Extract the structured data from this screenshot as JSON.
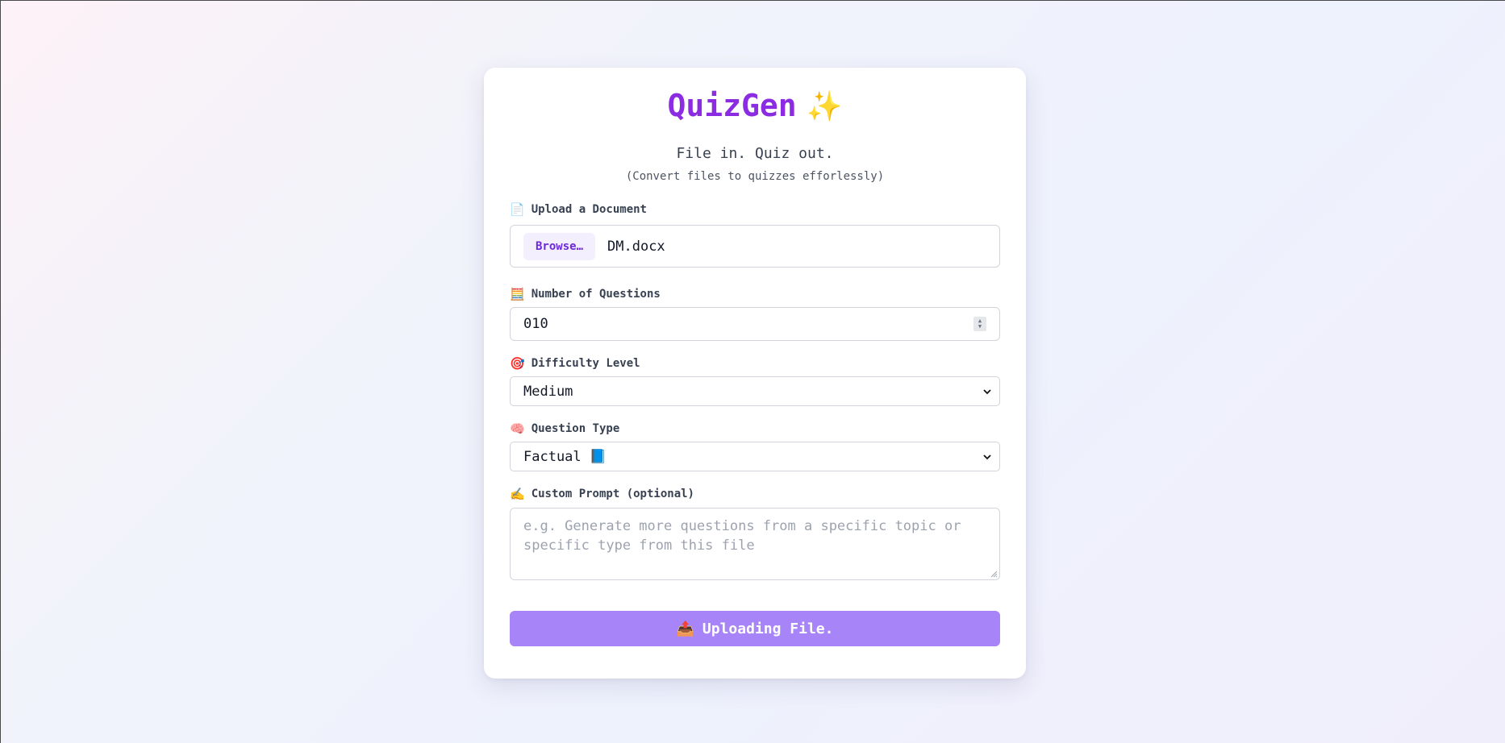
{
  "header": {
    "title": "QuizGen",
    "title_emoji": "✨",
    "subtitle": "File in. Quiz out.",
    "subnote": "(Convert files to quizzes efforlessly)"
  },
  "upload": {
    "icon": "📄",
    "label": "Upload a Document",
    "browse_label": "Browse…",
    "file_name": "DM.docx"
  },
  "questions": {
    "icon": "🧮",
    "label": "Number of Questions",
    "value": "010"
  },
  "difficulty": {
    "icon": "🎯",
    "label": "Difficulty Level",
    "selected": "Medium"
  },
  "question_type": {
    "icon": "🧠",
    "label": "Question Type",
    "selected": "Factual 📘"
  },
  "custom_prompt": {
    "icon": "✍️",
    "label": "Custom Prompt (optional)",
    "placeholder": "e.g. Generate more questions from a specific topic or specific type from this file"
  },
  "submit": {
    "icon": "📤",
    "label": "Uploading File."
  },
  "colors": {
    "accent": "#8b2be2",
    "button_bg": "#a784f7",
    "browse_bg": "#f3efff"
  }
}
